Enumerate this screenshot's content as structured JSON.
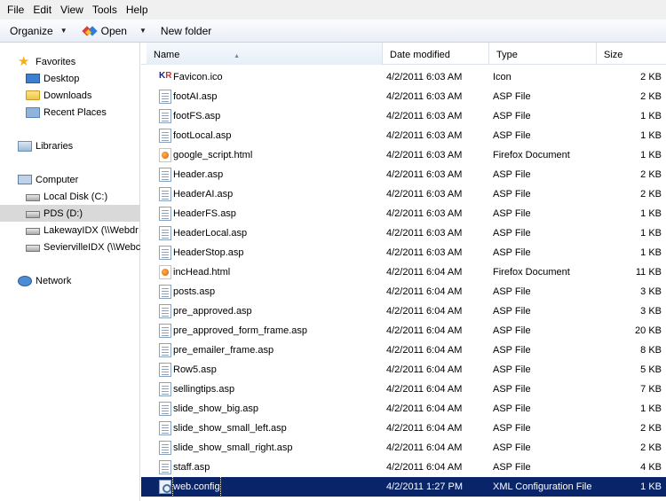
{
  "menu": [
    "File",
    "Edit",
    "View",
    "Tools",
    "Help"
  ],
  "toolbar": {
    "organize_label": "Organize",
    "open_label": "Open",
    "new_folder_label": "New folder"
  },
  "nav": {
    "favorites_label": "Favorites",
    "favorites": [
      {
        "label": "Desktop",
        "icon": "desktop-icon"
      },
      {
        "label": "Downloads",
        "icon": "folder-icon"
      },
      {
        "label": "Recent Places",
        "icon": "recent-places-icon"
      }
    ],
    "libraries_label": "Libraries",
    "computer_label": "Computer",
    "drives": [
      {
        "label": "Local Disk (C:)"
      },
      {
        "label": "PDS (D:)",
        "selected": true
      },
      {
        "label": "LakewayIDX (\\\\Webdr"
      },
      {
        "label": "SeviervilleIDX (\\\\Webc"
      }
    ],
    "network_label": "Network"
  },
  "columns": {
    "name": "Name",
    "date": "Date modified",
    "type": "Type",
    "size": "Size"
  },
  "files": [
    {
      "name": "Favicon.ico",
      "date": "4/2/2011 6:03 AM",
      "type": "Icon",
      "size": "2 KB",
      "icon": "kr"
    },
    {
      "name": "footAI.asp",
      "date": "4/2/2011 6:03 AM",
      "type": "ASP File",
      "size": "2 KB",
      "icon": "asp"
    },
    {
      "name": "footFS.asp",
      "date": "4/2/2011 6:03 AM",
      "type": "ASP File",
      "size": "1 KB",
      "icon": "asp"
    },
    {
      "name": "footLocal.asp",
      "date": "4/2/2011 6:03 AM",
      "type": "ASP File",
      "size": "1 KB",
      "icon": "asp"
    },
    {
      "name": "google_script.html",
      "date": "4/2/2011 6:03 AM",
      "type": "Firefox Document",
      "size": "1 KB",
      "icon": "ff"
    },
    {
      "name": "Header.asp",
      "date": "4/2/2011 6:03 AM",
      "type": "ASP File",
      "size": "2 KB",
      "icon": "asp"
    },
    {
      "name": "HeaderAI.asp",
      "date": "4/2/2011 6:03 AM",
      "type": "ASP File",
      "size": "2 KB",
      "icon": "asp"
    },
    {
      "name": "HeaderFS.asp",
      "date": "4/2/2011 6:03 AM",
      "type": "ASP File",
      "size": "1 KB",
      "icon": "asp"
    },
    {
      "name": "HeaderLocal.asp",
      "date": "4/2/2011 6:03 AM",
      "type": "ASP File",
      "size": "1 KB",
      "icon": "asp"
    },
    {
      "name": "HeaderStop.asp",
      "date": "4/2/2011 6:03 AM",
      "type": "ASP File",
      "size": "1 KB",
      "icon": "asp"
    },
    {
      "name": "incHead.html",
      "date": "4/2/2011 6:04 AM",
      "type": "Firefox Document",
      "size": "11 KB",
      "icon": "ff"
    },
    {
      "name": "posts.asp",
      "date": "4/2/2011 6:04 AM",
      "type": "ASP File",
      "size": "3 KB",
      "icon": "asp"
    },
    {
      "name": "pre_approved.asp",
      "date": "4/2/2011 6:04 AM",
      "type": "ASP File",
      "size": "3 KB",
      "icon": "asp"
    },
    {
      "name": "pre_approved_form_frame.asp",
      "date": "4/2/2011 6:04 AM",
      "type": "ASP File",
      "size": "20 KB",
      "icon": "asp"
    },
    {
      "name": "pre_emailer_frame.asp",
      "date": "4/2/2011 6:04 AM",
      "type": "ASP File",
      "size": "8 KB",
      "icon": "asp"
    },
    {
      "name": "Row5.asp",
      "date": "4/2/2011 6:04 AM",
      "type": "ASP File",
      "size": "5 KB",
      "icon": "asp"
    },
    {
      "name": "sellingtips.asp",
      "date": "4/2/2011 6:04 AM",
      "type": "ASP File",
      "size": "7 KB",
      "icon": "asp"
    },
    {
      "name": "slide_show_big.asp",
      "date": "4/2/2011 6:04 AM",
      "type": "ASP File",
      "size": "1 KB",
      "icon": "asp"
    },
    {
      "name": "slide_show_small_left.asp",
      "date": "4/2/2011 6:04 AM",
      "type": "ASP File",
      "size": "2 KB",
      "icon": "asp"
    },
    {
      "name": "slide_show_small_right.asp",
      "date": "4/2/2011 6:04 AM",
      "type": "ASP File",
      "size": "2 KB",
      "icon": "asp"
    },
    {
      "name": "staff.asp",
      "date": "4/2/2011 6:04 AM",
      "type": "ASP File",
      "size": "4 KB",
      "icon": "asp"
    },
    {
      "name": "web.config",
      "date": "4/2/2011 1:27 PM",
      "type": "XML Configuration File",
      "size": "1 KB",
      "icon": "cfg",
      "selected": true
    }
  ],
  "colors": {
    "selection": "#0a246a",
    "nav_selection": "#d9d9d9"
  }
}
